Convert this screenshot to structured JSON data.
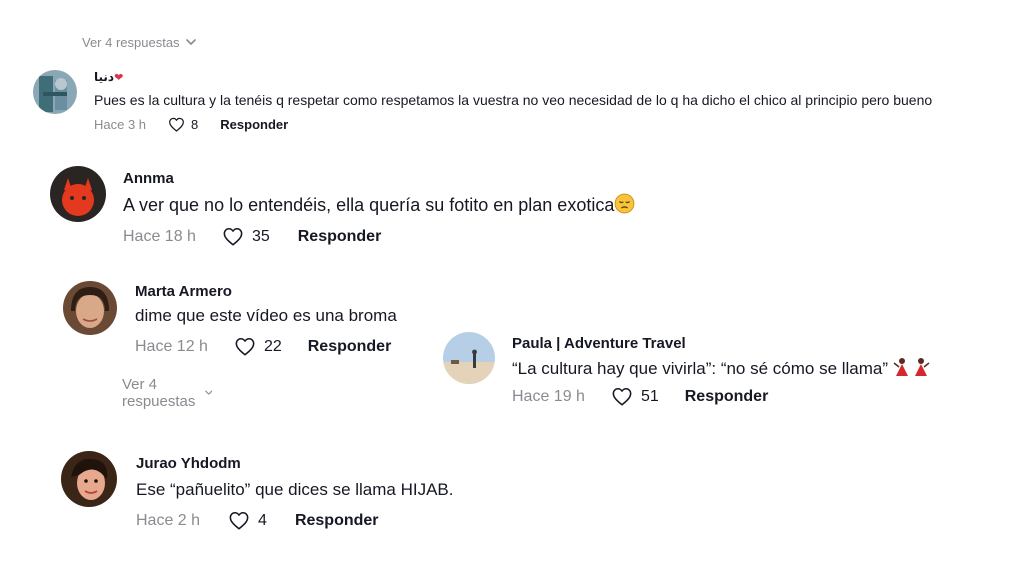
{
  "top_view_more": {
    "label": "Ver 4 respuestas"
  },
  "comments": [
    {
      "author": "دنيا",
      "author_suffix": "❤",
      "text": "Pues es la cultura y la tenéis q respetar como respetamos la vuestra no veo necesidad de lo q ha dicho el chico al principio pero bueno",
      "time": "Hace 3 h",
      "likes": "8",
      "reply_label": "Responder"
    },
    {
      "author": "Annma",
      "text": "A ver que no lo entendéis, ella quería su fotito en plan exotica",
      "emoji": "pensive-face",
      "time": "Hace 18 h",
      "likes": "35",
      "reply_label": "Responder"
    },
    {
      "author": "Marta Armero",
      "text": "dime que este vídeo es una broma",
      "time": "Hace 12 h",
      "likes": "22",
      "reply_label": "Responder",
      "view_more": "Ver 4 respuestas"
    },
    {
      "author": "Paula | Adventure Travel",
      "text": "“La cultura hay que vivirla”: “no sé cómo se llama”",
      "emoji": "dancer-pair",
      "time": "Hace 19 h",
      "likes": "51",
      "reply_label": "Responder"
    },
    {
      "author": "Jurao Yhdodm",
      "text": "Ese “pañuelito” que dices se llama HIJAB.",
      "time": "Hace 2 h",
      "likes": "4",
      "reply_label": "Responder"
    }
  ],
  "icons": {
    "like": "heart-outline-icon",
    "expand": "chevron-down-icon"
  },
  "colors": {
    "text": "#161823",
    "muted": "#8a8b91",
    "background": "#ffffff"
  }
}
